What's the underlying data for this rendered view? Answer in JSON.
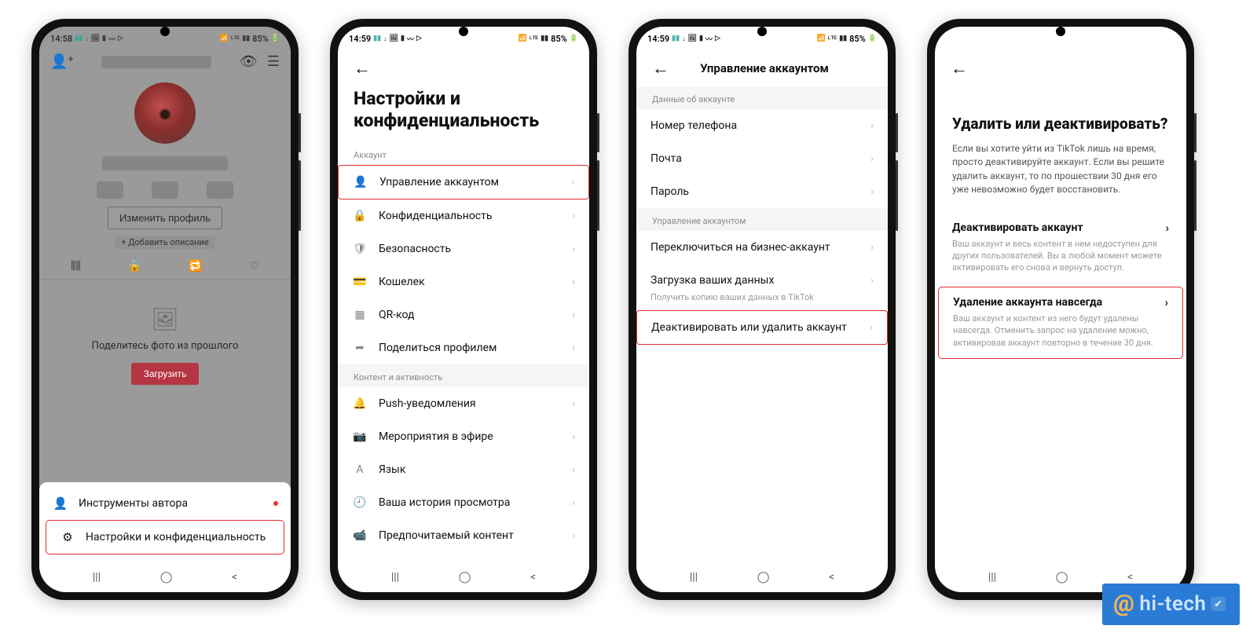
{
  "status": {
    "t1": "14:58",
    "t2": "14:59",
    "t3": "14:59",
    "battery": "85%"
  },
  "nav": [
    "|||",
    "◯",
    "<"
  ],
  "phone1": {
    "edit_profile": "Изменить профиль",
    "add_desc": "+ Добавить описание",
    "empty_photo": "Поделитесь фото из прошлого",
    "load": "Загрузить",
    "sheet": {
      "creator_tools": "Инструменты автора",
      "settings_privacy": "Настройки и конфиденциальность"
    }
  },
  "phone2": {
    "title": "Настройки и конфиденциальность",
    "sec_account": "Аккаунт",
    "rows1": [
      {
        "icon": "👤",
        "label": "Управление аккаунтом",
        "hl": true
      },
      {
        "icon": "🔒",
        "label": "Конфиденциальность"
      },
      {
        "icon": "🛡",
        "label": "Безопасность"
      },
      {
        "icon": "💳",
        "label": "Кошелек"
      },
      {
        "icon": "▦",
        "label": "QR-код"
      },
      {
        "icon": "➦",
        "label": "Поделиться профилем"
      }
    ],
    "sec_content": "Контент и активность",
    "rows2": [
      {
        "icon": "🔔",
        "label": "Push-уведомления"
      },
      {
        "icon": "📷",
        "label": "Мероприятия в эфире"
      },
      {
        "icon": "A",
        "label": "Язык"
      },
      {
        "icon": "🕘",
        "label": "Ваша история просмотра"
      },
      {
        "icon": "📹",
        "label": "Предпочитаемый контент"
      }
    ]
  },
  "phone3": {
    "title": "Управление аккаунтом",
    "sec_info": "Данные об аккаунте",
    "rows1": [
      {
        "label": "Номер телефона"
      },
      {
        "label": "Почта"
      },
      {
        "label": "Пароль"
      }
    ],
    "sec_mgmt": "Управление аккаунтом",
    "rows2": [
      {
        "label": "Переключиться на бизнес-аккаунт"
      },
      {
        "label": "Загрузка ваших данных",
        "sub": "Получить копию ваших данных в TikTok"
      },
      {
        "label": "Деактивировать или удалить аккаунт",
        "hl": true
      }
    ]
  },
  "phone4": {
    "title": "Удалить или деактивировать?",
    "desc": "Если вы хотите уйти из TikTok лишь на время, просто деактивируйте аккаунт. Если вы решите удалить аккаунт, то по прошествии 30 дня его уже невозможно будет восстановить.",
    "deactivate": {
      "head": "Деактивировать аккаунт",
      "sub": "Ваш аккаунт и весь контент в нем недоступен для других пользователей. Вы в любой момент можете активировать его снова и вернуть доступ."
    },
    "delete": {
      "head": "Удаление аккаунта навсегда",
      "sub": "Ваш аккаунт и контент из него будут удалены навсегда. Отменить запрос на удаление можно, активировав аккаунт повторно в течение 30 дня."
    }
  },
  "watermark": "hi-tech"
}
